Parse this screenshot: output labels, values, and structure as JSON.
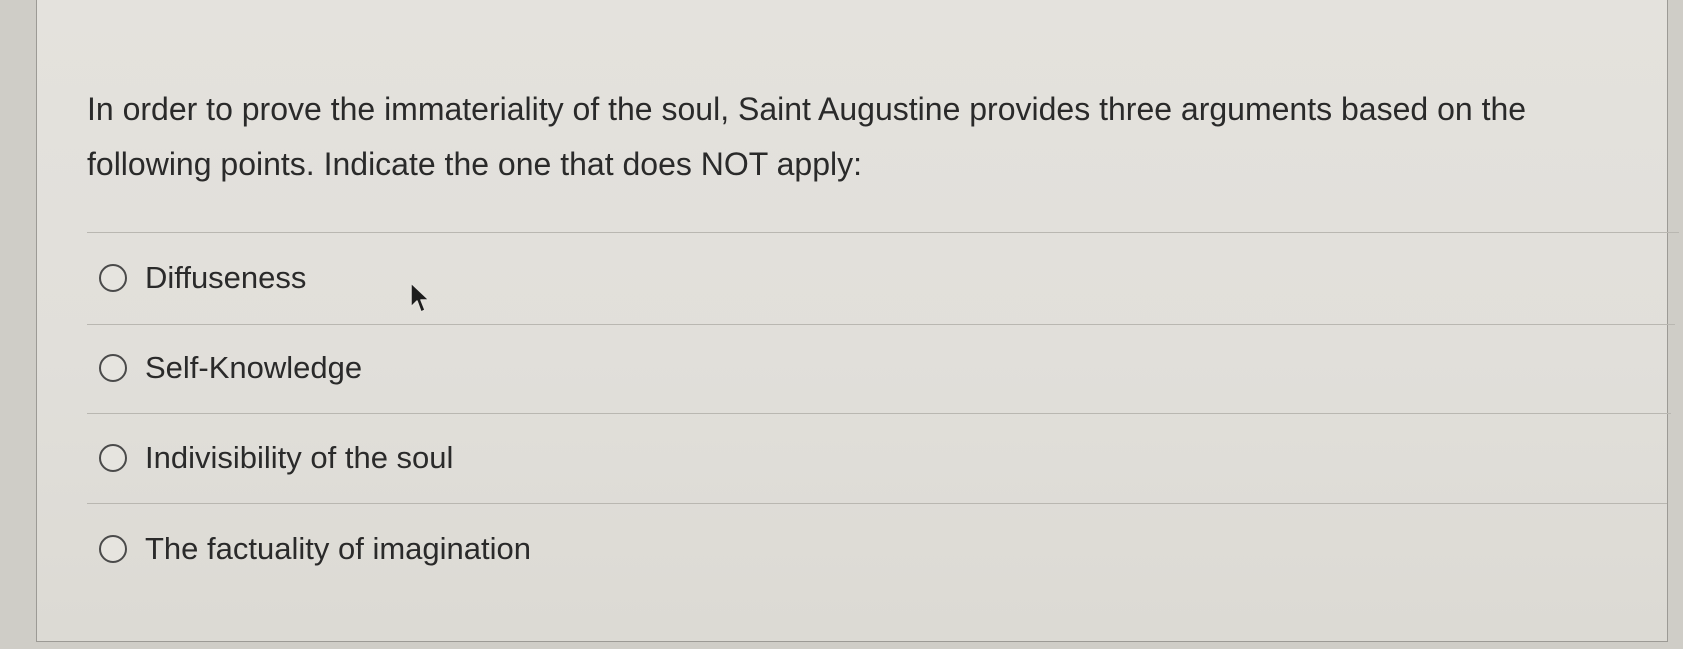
{
  "question": {
    "text": "In order to prove the immateriality of the soul, Saint Augustine provides three arguments based on the following points. Indicate the one that does NOT apply:"
  },
  "options": [
    {
      "label": "Diffuseness",
      "selected": false
    },
    {
      "label": "Self-Knowledge",
      "selected": false
    },
    {
      "label": "Indivisibility of the soul",
      "selected": false
    },
    {
      "label": "The factuality of imagination",
      "selected": false
    }
  ],
  "icons": {
    "radio": "radio-unselected-icon",
    "pointer": "mouse-pointer-icon"
  },
  "colors": {
    "text": "#2a2a2a",
    "card_background": "#e3e1dc",
    "divider": "#b9b7b1"
  }
}
